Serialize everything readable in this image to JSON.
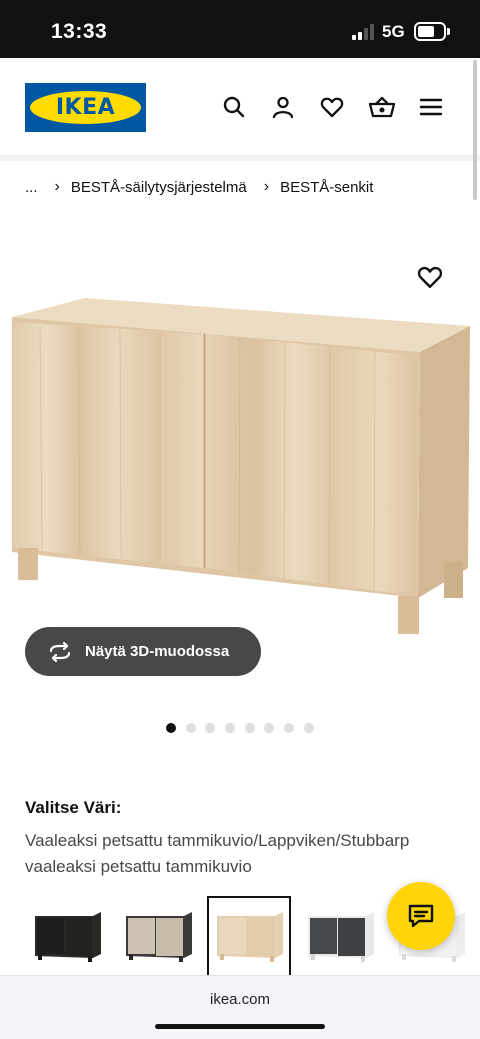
{
  "status_bar": {
    "time": "13:33",
    "network": "5G",
    "icons": [
      "signal-icon",
      "battery-icon"
    ]
  },
  "header": {
    "logo_text": "IKEA",
    "icons": [
      "search-icon",
      "account-icon",
      "heart-icon",
      "basket-icon",
      "menu-icon"
    ]
  },
  "breadcrumb": {
    "ellipsis": "...",
    "items": [
      "BESTÅ-säilytysjärjestelmä",
      "BESTÅ-senkit"
    ]
  },
  "gallery": {
    "view_3d_label": "Näytä 3D-muodossa",
    "slide_count": 8,
    "active_slide": 1
  },
  "color_selector": {
    "heading": "Valitse Väri:",
    "selected_value": "Vaaleaksi petsattu tammikuvio/Lappviken/Stubbarp vaaleaksi petsattu tammikuvio",
    "selected_index": 2,
    "swatches": [
      {
        "name": "black-brown",
        "body": "#2b2926",
        "door": "#1f1d1b"
      },
      {
        "name": "beige",
        "body": "#3b3a39",
        "door": "#cdc3b3"
      },
      {
        "name": "white-stained-oak",
        "body": "#e4cfb0",
        "door": "#ead8bc"
      },
      {
        "name": "dark-grey",
        "body": "#e9e9e9",
        "door": "#45484a"
      },
      {
        "name": "white",
        "body": "#f4f4f4",
        "door": "#f7f7f7"
      }
    ]
  },
  "browser": {
    "url": "ikea.com"
  },
  "colors": {
    "brand_blue": "#0058a3",
    "brand_yellow": "#ffdb00",
    "fab_yellow": "#ffd50a",
    "button_dark": "#484848"
  }
}
